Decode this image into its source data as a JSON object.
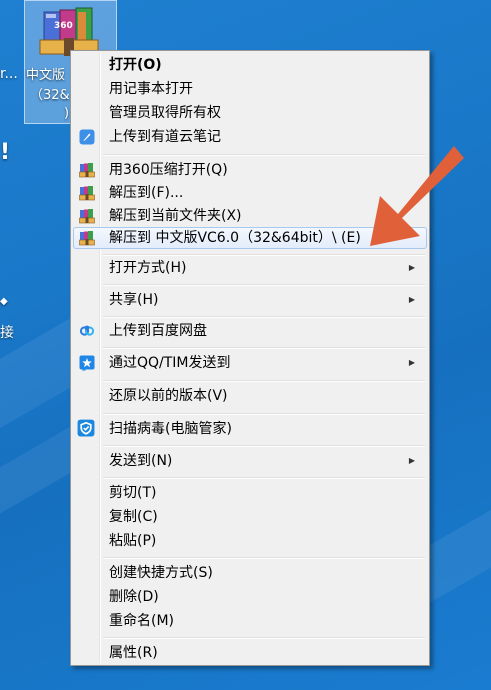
{
  "desktop": {
    "selected_icon_label_1": "中文版",
    "selected_icon_label_2": "（32&",
    "selected_icon_label_3": ")",
    "left_edge_label": "r...",
    "left_edge_bottom_char": "接"
  },
  "menu": {
    "items": [
      {
        "label": "打开(O)",
        "icon": "none"
      },
      {
        "label": "用记事本打开",
        "icon": "none"
      },
      {
        "label": "管理员取得所有权",
        "icon": "none"
      },
      {
        "label": "上传到有道云笔记",
        "icon": "youdao-note-icon"
      },
      {
        "label": "用360压缩打开(Q)",
        "icon": "compress-archive-icon"
      },
      {
        "label": "解压到(F)...",
        "icon": "compress-archive-icon"
      },
      {
        "label": "解压到当前文件夹(X)",
        "icon": "compress-archive-icon"
      },
      {
        "label": "解压到 中文版VC6.0（32&64bit）\\ (E)",
        "icon": "compress-archive-icon"
      },
      {
        "label": "打开方式(H)",
        "icon": "none"
      },
      {
        "label": "共享(H)",
        "icon": "none"
      },
      {
        "label": "上传到百度网盘",
        "icon": "baidu-netdisk-icon"
      },
      {
        "label": "通过QQ/TIM发送到",
        "icon": "qq-tim-icon"
      },
      {
        "label": "还原以前的版本(V)",
        "icon": "none"
      },
      {
        "label": "扫描病毒(电脑管家)",
        "icon": "pc-manager-shield-icon"
      },
      {
        "label": "发送到(N)",
        "icon": "none"
      },
      {
        "label": "剪切(T)",
        "icon": "none"
      },
      {
        "label": "复制(C)",
        "icon": "none"
      },
      {
        "label": "粘贴(P)",
        "icon": "none"
      },
      {
        "label": "创建快捷方式(S)",
        "icon": "none"
      },
      {
        "label": "删除(D)",
        "icon": "none"
      },
      {
        "label": "重命名(M)",
        "icon": "none"
      },
      {
        "label": "属性(R)",
        "icon": "none"
      }
    ]
  },
  "colors": {
    "desktop_blue": "#1a78c9",
    "menu_background": "#f0f0f0",
    "highlight_border": "#a8c8ec",
    "annotation_arrow": "#e0603a"
  }
}
